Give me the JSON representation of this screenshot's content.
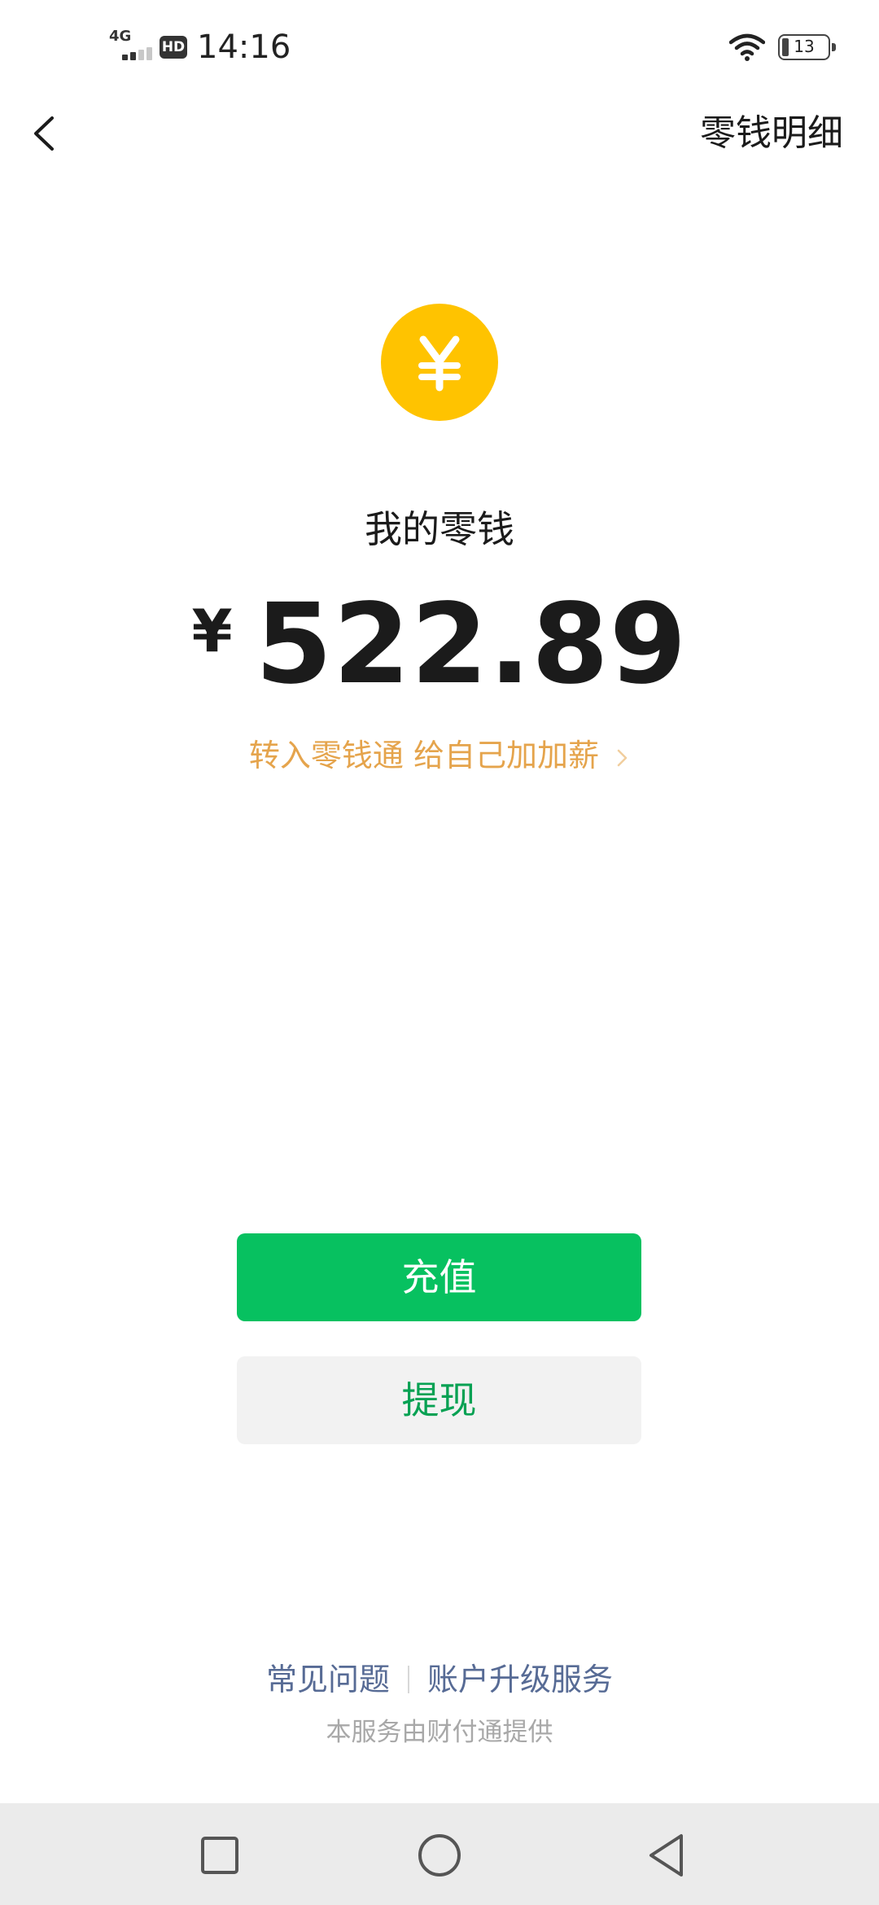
{
  "status_bar": {
    "network": "4G",
    "hd": "HD",
    "time": "14:16",
    "battery": "13"
  },
  "nav": {
    "back_icon": "chevron-left-icon",
    "detail_link": "零钱明细"
  },
  "wallet": {
    "icon": "yuan-coin-icon",
    "icon_color": "#FFC300",
    "label": "我的零钱",
    "currency": "¥",
    "amount": "522.89",
    "promo": "转入零钱通 给自己加加薪",
    "promo_color": "#E5A44C"
  },
  "buttons": {
    "recharge": "充值",
    "withdraw": "提现",
    "accent_color": "#07C160"
  },
  "footer": {
    "faq": "常见问题",
    "upgrade": "账户升级服务",
    "provider": "本服务由财付通提供"
  },
  "system_nav": {
    "recent": "square-icon",
    "home": "circle-icon",
    "back": "triangle-back-icon"
  }
}
